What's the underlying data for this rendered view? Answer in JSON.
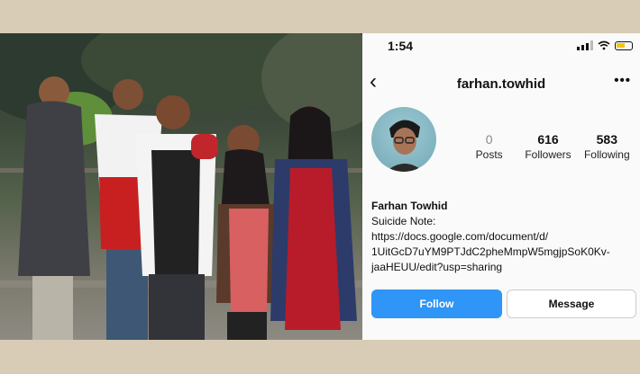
{
  "status_bar": {
    "time": "1:54"
  },
  "profile": {
    "username": "farhan.towhid",
    "stats": [
      {
        "value": "0",
        "label": "Posts"
      },
      {
        "value": "616",
        "label": "Followers"
      },
      {
        "value": "583",
        "label": "Following"
      }
    ],
    "bio": {
      "name": "Farhan Towhid",
      "line1": "Suicide Note:",
      "line2": "https://docs.google.com/document/d/",
      "line3": "1UitGcD7uYM9PTJdC2pheMmpW5mgjpSoK0Kv-",
      "line4": "jaaHEUU/edit?usp=sharing"
    },
    "buttons": {
      "follow": "Follow",
      "message": "Message"
    }
  },
  "colors": {
    "follow_button": "#2f95f6",
    "background_border": "#d8ccb6"
  }
}
